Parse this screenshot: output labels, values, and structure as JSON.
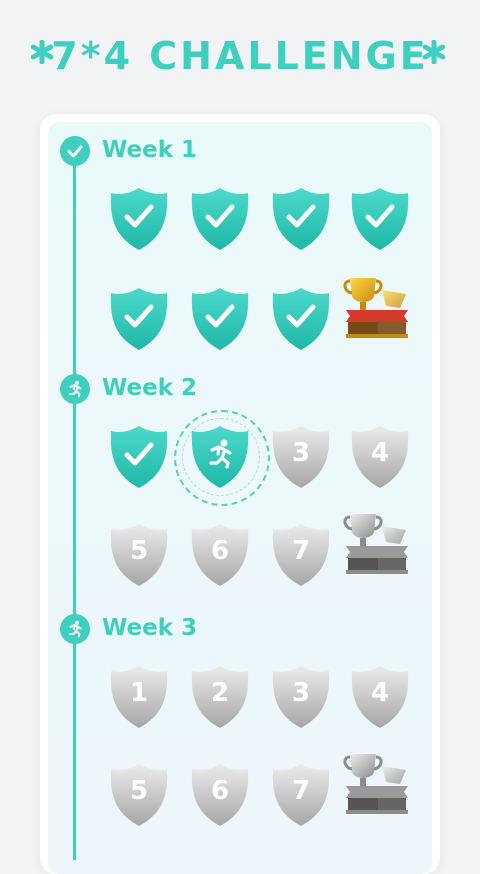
{
  "header": {
    "title": "7*4 CHALLENGE"
  },
  "colors": {
    "accent": "#3fcfc0",
    "pending": "#c8c8c8",
    "gold": "#e8b625"
  },
  "weeks": [
    {
      "label": "Week 1",
      "icon": "check-icon",
      "status": "completed",
      "days": [
        "done",
        "done",
        "done",
        "done",
        "done",
        "done",
        "done"
      ],
      "trophy": "gold"
    },
    {
      "label": "Week 2",
      "icon": "runner-icon",
      "status": "in-progress",
      "days": [
        "done",
        "current",
        "3",
        "4",
        "5",
        "6",
        "7"
      ],
      "trophy": "silver"
    },
    {
      "label": "Week 3",
      "icon": "runner-icon",
      "status": "locked",
      "days": [
        "1",
        "2",
        "3",
        "4",
        "5",
        "6",
        "7"
      ],
      "trophy": "silver"
    }
  ]
}
